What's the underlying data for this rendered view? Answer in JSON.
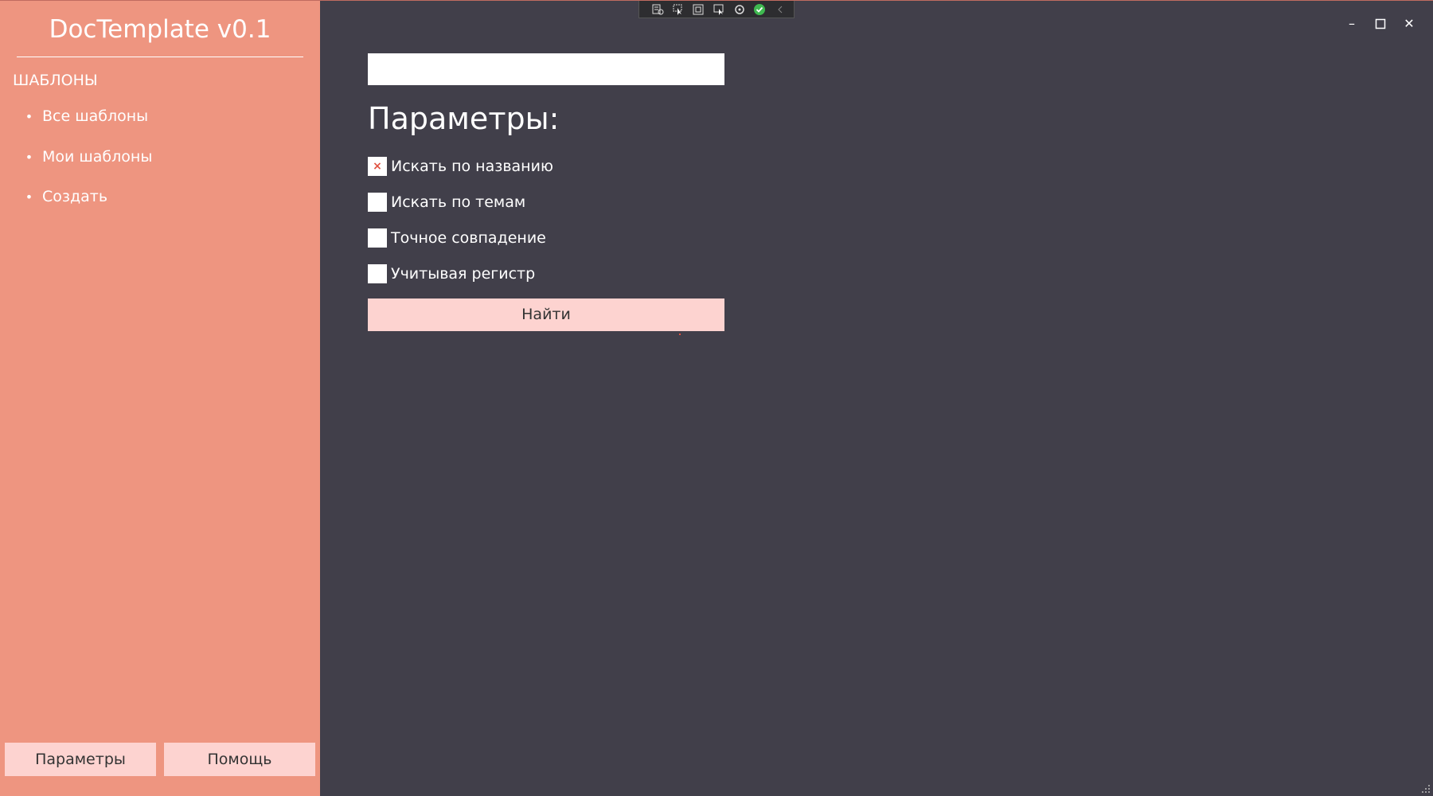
{
  "app": {
    "title": "DocTemplate v0.1"
  },
  "sidebar": {
    "section_title": "ШАБЛОНЫ",
    "bullet": "•",
    "items": [
      {
        "label": "Все шаблоны"
      },
      {
        "label": "Мои шаблоны"
      },
      {
        "label": "Создать"
      }
    ],
    "buttons": {
      "params": "Параметры",
      "help": "Помощь"
    }
  },
  "main": {
    "search": {
      "value": "",
      "placeholder": ""
    },
    "heading": "Параметры:",
    "options": [
      {
        "label": "Искать по названию",
        "checked": true
      },
      {
        "label": "Искать по темам",
        "checked": false
      },
      {
        "label": "Точное совпадение",
        "checked": false
      },
      {
        "label": "Учитывая регистр",
        "checked": false
      }
    ],
    "check_mark": "×",
    "find_button": "Найти"
  },
  "window_controls": {
    "minimize": "–",
    "maximize": "☐",
    "close": "✕"
  },
  "debug_toolbar": {
    "icons": [
      "live-visual-tree-icon",
      "select-element-icon",
      "display-layout-adorners-icon",
      "track-focus-icon",
      "hot-reload-icon",
      "binding-check-icon",
      "collapse-chevron-icon"
    ]
  },
  "colors": {
    "sidebar_bg": "#ee9580",
    "main_bg": "#413f4a",
    "button_bg": "#fdd3d0",
    "check_mark": "#e0503f",
    "text_light": "#ffffff"
  }
}
